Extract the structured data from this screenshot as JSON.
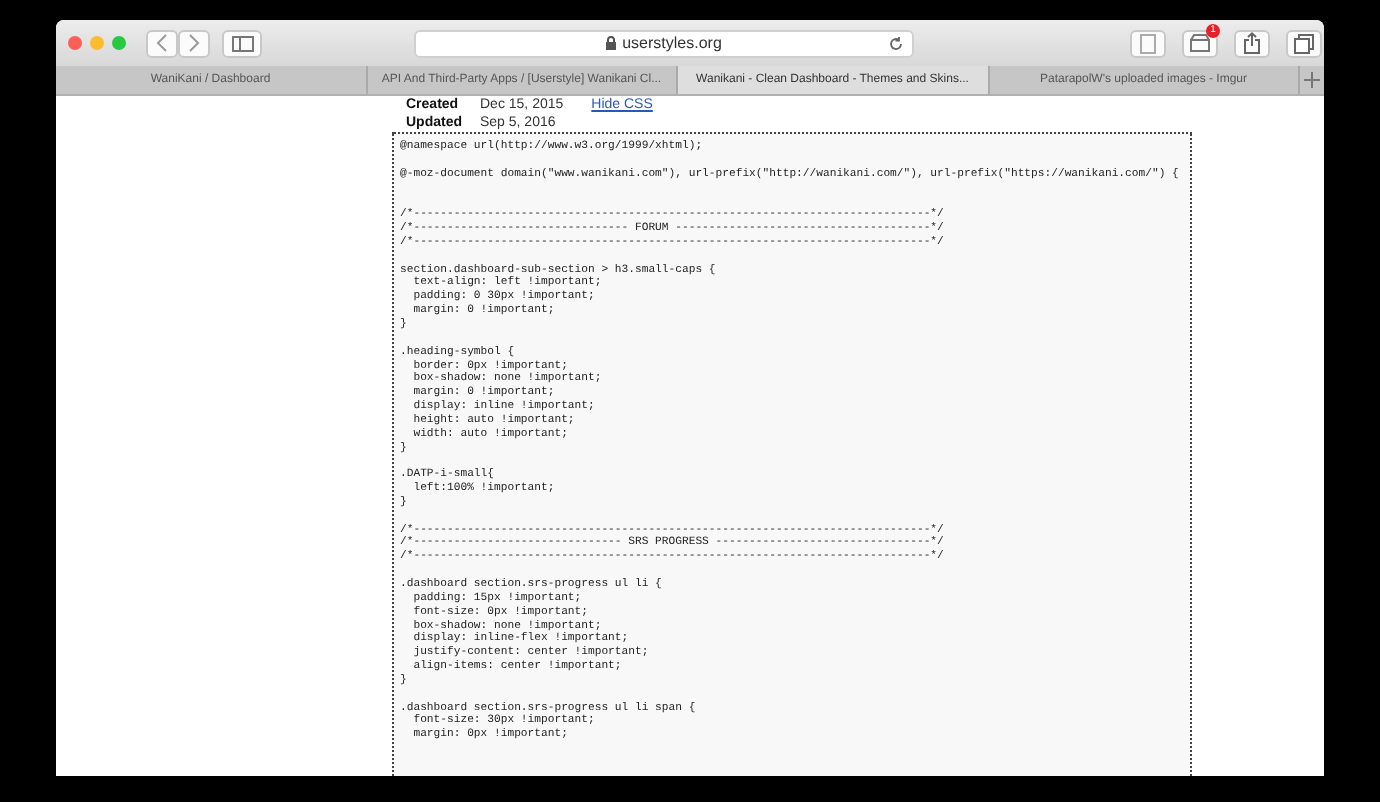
{
  "toolbar": {
    "address": "userstyles.org",
    "badge": "1"
  },
  "tabs": [
    {
      "label": "WaniKani / Dashboard",
      "selected": false
    },
    {
      "label": "API And Third-Party Apps / [Userstyle] Wanikani Cl...",
      "selected": false
    },
    {
      "label": "Wanikani - Clean Dashboard - Themes and Skins...",
      "selected": true
    },
    {
      "label": "PatarapolW's uploaded images - Imgur",
      "selected": false
    }
  ],
  "style_info": {
    "created_label": "Created",
    "created": "Dec 15, 2015",
    "updated_label": "Updated",
    "updated": "Sep 5, 2016",
    "toggle_link": "Hide CSS"
  },
  "code": "@namespace url(http://www.w3.org/1999/xhtml);\n\n@-moz-document domain(\"www.wanikani.com\"), url-prefix(\"http://wanikani.com/\"), url-prefix(\"https://wanikani.com/\") {\n\n\n/*-----------------------------------------------------------------------------*/\n/*-------------------------------- FORUM --------------------------------------*/\n/*-----------------------------------------------------------------------------*/\n\nsection.dashboard-sub-section > h3.small-caps {\n  text-align: left !important;\n  padding: 0 30px !important;\n  margin: 0 !important;\n}\n\n.heading-symbol {\n  border: 0px !important;\n  box-shadow: none !important;\n  margin: 0 !important;\n  display: inline !important;\n  height: auto !important;\n  width: auto !important;\n}\n\n.DATP-i-small{\n  left:100% !important;\n}\n\n/*-----------------------------------------------------------------------------*/\n/*------------------------------- SRS PROGRESS --------------------------------*/\n/*-----------------------------------------------------------------------------*/\n\n.dashboard section.srs-progress ul li {\n  padding: 15px !important;\n  font-size: 0px !important;\n  box-shadow: none !important;\n  display: inline-flex !important;\n  justify-content: center !important;\n  align-items: center !important;\n}\n\n.dashboard section.srs-progress ul li span {\n  font-size: 30px !important;\n  margin: 0px !important;"
}
